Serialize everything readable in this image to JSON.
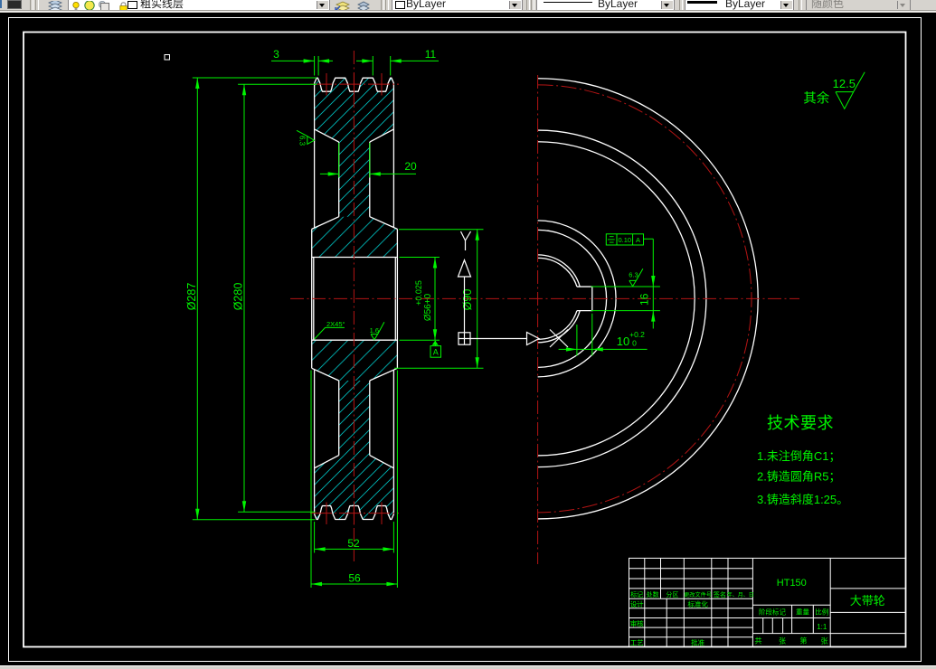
{
  "toolbar": {
    "layer_combo": {
      "value": "粗实线层"
    },
    "color_combo": {
      "value": "ByLayer"
    },
    "linetype_combo": {
      "value": "ByLayer"
    },
    "lineweight_combo": {
      "value": "ByLayer"
    },
    "plotstyle_combo": {
      "value": "随颜色"
    }
  },
  "colors": {
    "background": "#000000",
    "geometry": "#ffffff",
    "annotation": "#00f400",
    "centerline": "#b41414",
    "hatch": "#00c8c8",
    "toolbar_bg": "#d6d3ce"
  },
  "drawing": {
    "dims": {
      "groove_offset": "3",
      "groove_width": "11",
      "web_width": "20",
      "od": "Ø287",
      "pitch_d": "Ø280",
      "bore_main": "Ø56+0",
      "bore_tol_up": "+0.025",
      "hub_d": "Ø90",
      "rim_w": "52",
      "hub_len": "56",
      "key_w": "16",
      "key_d": "10",
      "key_d_tol_up": "+0.2",
      "key_d_tol_low": "0",
      "chamfer": "2X45°"
    },
    "gdt": {
      "tolerance": "0.10",
      "datum": "A"
    },
    "datum_label": "A",
    "roughness": {
      "other_prefix": "其余",
      "other_value": "12.5",
      "rim_side": "6.3",
      "bore": "1.6",
      "keyway": "6.3"
    },
    "ucs": {
      "x": "X",
      "y": "Y"
    },
    "tech_req": {
      "title": "技术要求",
      "items": [
        "1.未注倒角C1；",
        "2.铸造圆角R5；",
        "3.铸造斜度1:25。"
      ]
    },
    "title_block": {
      "material": "HT150",
      "part_name": "大带轮",
      "scale_value": "1:1",
      "row_labels": [
        "标记",
        "处数",
        "分区",
        "更改文件号",
        "签名",
        "年、月、日"
      ],
      "design": "设计",
      "standardize": "标准化",
      "review": "审核",
      "process": "工艺",
      "approve": "批准",
      "stage": "阶段标记",
      "weight": "重量",
      "scale": "比例",
      "sheet_total": "共",
      "sheet_zhang1": "张",
      "sheet_no": "第",
      "sheet_zhang2": "张"
    }
  }
}
